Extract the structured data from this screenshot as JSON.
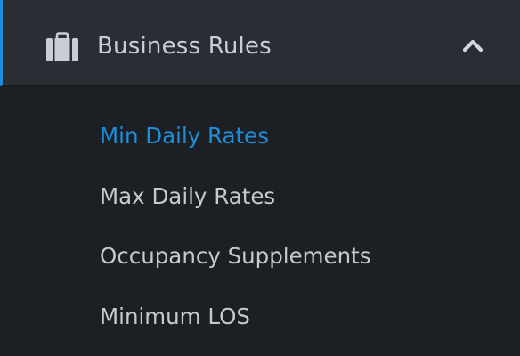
{
  "group": {
    "icon": "briefcase-icon",
    "label": "Business Rules",
    "toggle_icon": "chevron-up-icon",
    "expanded": true
  },
  "submenu": {
    "items": [
      {
        "label": "Min Daily Rates",
        "active": true
      },
      {
        "label": "Max Daily Rates",
        "active": false
      },
      {
        "label": "Occupancy Supplements",
        "active": false
      },
      {
        "label": "Minimum LOS",
        "active": false
      }
    ]
  },
  "colors": {
    "accent": "#1f8ed8",
    "header_bg": "#2a2e34",
    "menu_bg": "#1c1f24",
    "text": "#c4c9cf"
  }
}
